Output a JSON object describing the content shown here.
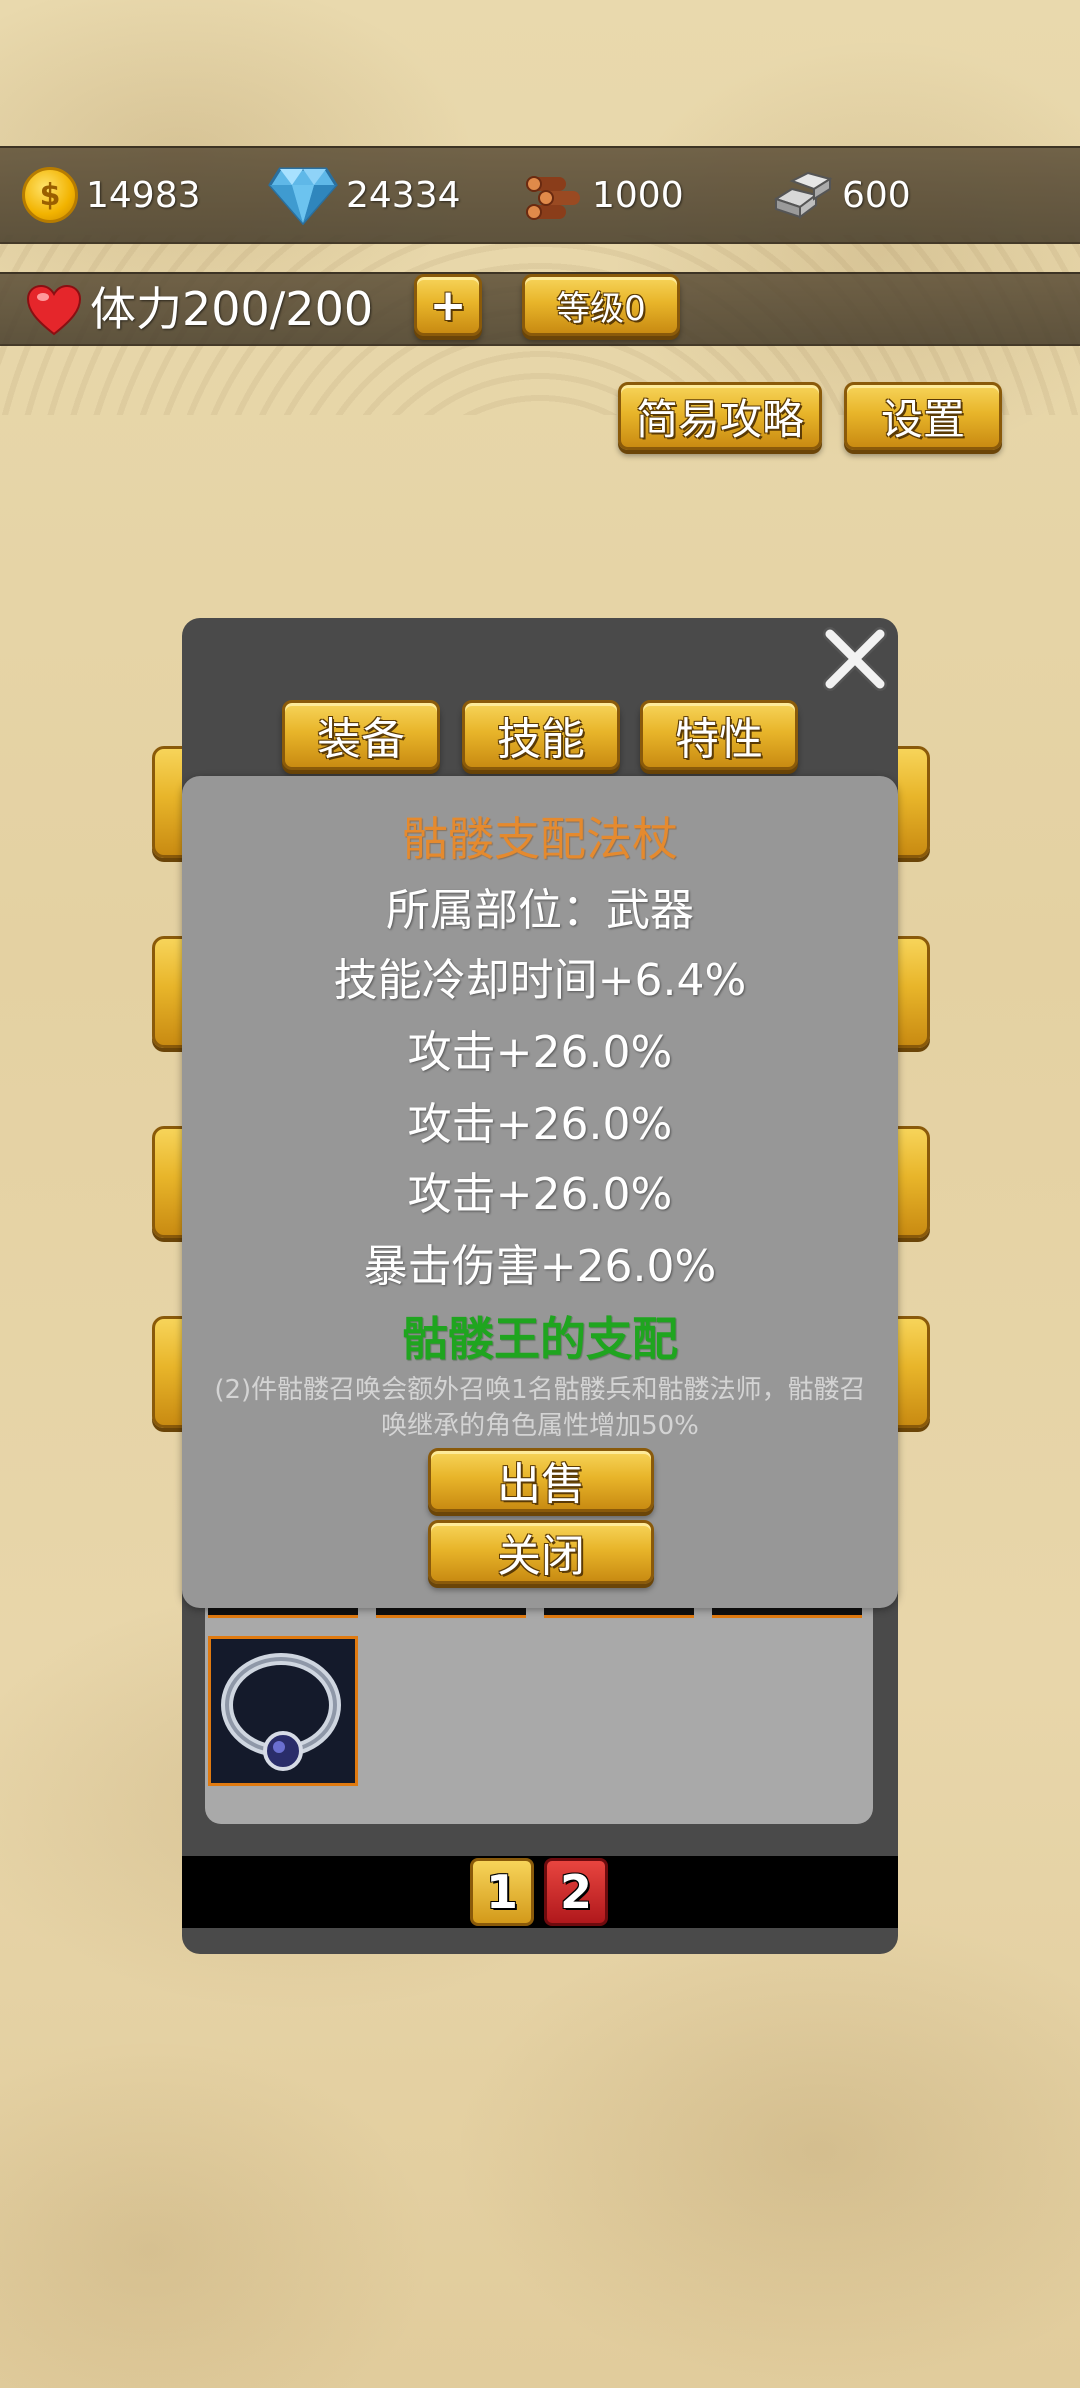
{
  "resources": {
    "gold": "14983",
    "diamond": "24334",
    "wood": "1000",
    "iron": "600"
  },
  "stamina": {
    "label": "体力200/200",
    "add_label": "+",
    "level_label": "等级0"
  },
  "top_buttons": {
    "guide": "简易攻略",
    "settings": "设置"
  },
  "dialog": {
    "tabs": [
      "装备",
      "技能",
      "特性"
    ],
    "pages": [
      "1",
      "2"
    ],
    "selected_page": "2"
  },
  "item_detail": {
    "name": "骷髅支配法杖",
    "slot": "所属部位：武器",
    "stats": [
      "技能冷却时间+6.4%",
      "攻击+26.0%",
      "攻击+26.0%",
      "攻击+26.0%",
      "暴击伤害+26.0%"
    ],
    "set_name": "骷髅王的支配",
    "set_desc_line1": "(2)件骷髅召唤会额外召唤1名骷髅兵和骷髅法师，骷髅召",
    "set_desc_line2": "唤继承的角色属性增加50%",
    "sell_label": "出售",
    "close_label": "关闭"
  },
  "colors": {
    "item_name": "#e58a2e",
    "set_name": "#1fa51f",
    "button_gold": "#e8b52a",
    "selected_page": "#d9252a"
  }
}
